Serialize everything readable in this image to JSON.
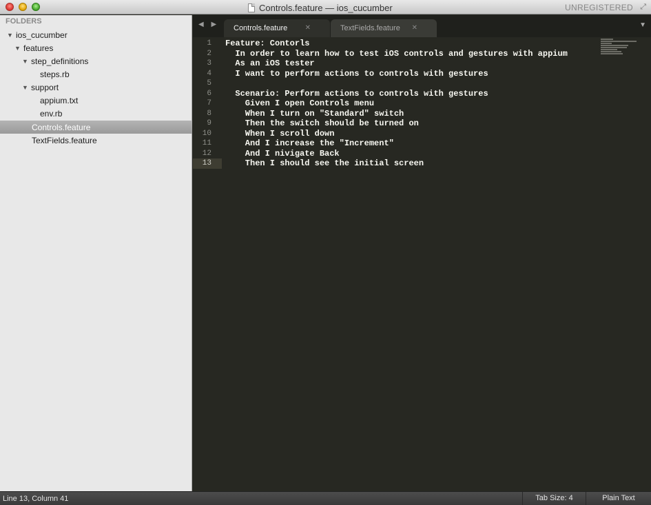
{
  "window": {
    "title": "Controls.feature — ios_cucumber",
    "registration": "UNREGISTERED"
  },
  "sidebar": {
    "header": "FOLDERS",
    "items": [
      {
        "label": "ios_cucumber",
        "expanded": true
      },
      {
        "label": "features",
        "expanded": true
      },
      {
        "label": "step_definitions",
        "expanded": true
      },
      {
        "label": "steps.rb"
      },
      {
        "label": "support",
        "expanded": true
      },
      {
        "label": "appium.txt"
      },
      {
        "label": "env.rb"
      },
      {
        "label": "Controls.feature",
        "selected": true
      },
      {
        "label": "TextFields.feature"
      }
    ]
  },
  "tabs": [
    {
      "label": "Controls.feature",
      "active": true
    },
    {
      "label": "TextFields.feature",
      "active": false
    }
  ],
  "editor": {
    "current_line": 13,
    "lines": [
      "Feature: Contorls",
      "  In order to learn how to test iOS controls and gestures with appium",
      "  As an iOS tester",
      "  I want to perform actions to controls with gestures",
      "",
      "  Scenario: Perform actions to controls with gestures",
      "    Given I open Controls menu",
      "    When I turn on \"Standard\" switch",
      "    Then the switch should be turned on",
      "    When I scroll down",
      "    And I increase the \"Increment\"",
      "    And I nivigate Back",
      "    Then I should see the initial screen"
    ],
    "line_numbers": [
      "1",
      "2",
      "3",
      "4",
      "5",
      "6",
      "7",
      "8",
      "9",
      "10",
      "11",
      "12",
      "13"
    ]
  },
  "statusbar": {
    "position": "Line 13, Column 41",
    "tab_size": "Tab Size: 4",
    "syntax": "Plain Text"
  },
  "colors": {
    "editor_bg": "#272822",
    "sidebar_bg": "#e8e8e8",
    "text": "#f8f8f2",
    "gutter_text": "#8f908a"
  }
}
